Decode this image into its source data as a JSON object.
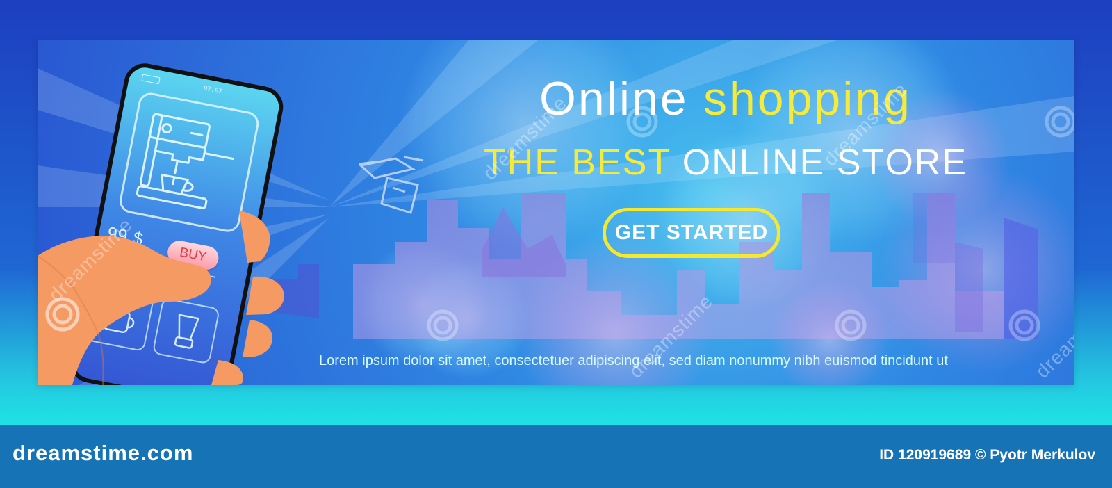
{
  "banner": {
    "title_part1": "Online",
    "title_part2": "shopping",
    "subtitle_part1": "THE BEST",
    "subtitle_part2": "ONLINE STORE",
    "cta_label": "GET STARTED",
    "lorem": "Lorem ipsum dolor sit amet, consectetuer adipiscing elit, sed diam nonummy nibh euismod tincidunt ut"
  },
  "phone": {
    "time": "07:07",
    "price": "99 $",
    "buy_label": "BUY",
    "product_icon": "coffee-machine-icon"
  },
  "footer": {
    "logo_text": "dreamstime.com",
    "credit": "ID 120919689 © Pyotr Merkulov"
  },
  "watermark": {
    "text": "dreamstime"
  },
  "colors": {
    "top_background": "#1d3fc0",
    "banner_blue": "#2f86e3",
    "accent_yellow": "#f6ea3a",
    "footer_bar": "#1573b6",
    "buy_text": "#e03d45"
  }
}
